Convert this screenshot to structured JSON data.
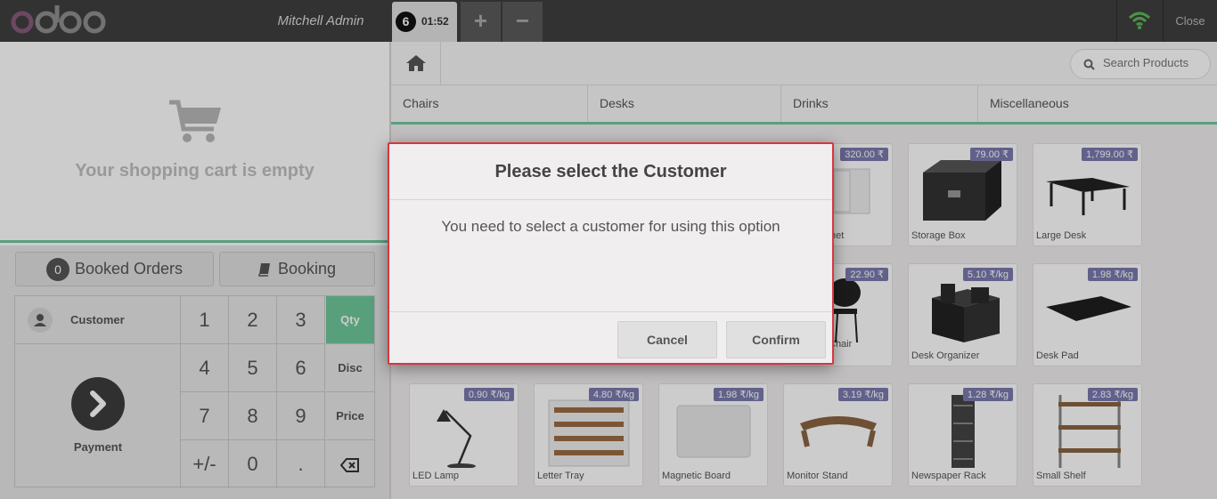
{
  "header": {
    "user_name": "Mitchell Admin",
    "order_number": "6",
    "order_time": "01:52",
    "add_label": "+",
    "remove_label": "−",
    "close_label": "Close",
    "logo_icon": "odoo-logo",
    "wifi_icon": "wifi-icon",
    "wifi_color": "#5cb85c"
  },
  "cart": {
    "empty_text": "Your shopping cart is empty",
    "icon": "cart-icon"
  },
  "controls": {
    "booked_count": "0",
    "booked_label": "Booked Orders",
    "booking_label": "Booking"
  },
  "pad": {
    "customer_label": "Customer",
    "payment_label": "Payment",
    "keys": [
      "1",
      "2",
      "3",
      "Qty",
      "4",
      "5",
      "6",
      "Disc",
      "7",
      "8",
      "9",
      "Price",
      "+/-",
      "0",
      "."
    ],
    "backspace_icon": "backspace-icon",
    "selected_mode": "Qty",
    "accent_color": "#6ec89b"
  },
  "products_header": {
    "search_placeholder": "Search Products",
    "categories": [
      "Chairs",
      "Desks",
      "Drinks",
      "Miscellaneous"
    ]
  },
  "products": [
    {
      "name": "Cabinet",
      "price": "320.00 ₹"
    },
    {
      "name": "Storage Box",
      "price": "79.00 ₹"
    },
    {
      "name": "Large Desk",
      "price": "1,799.00 ₹"
    },
    {
      "name": "Conference Chair",
      "price": "22.90 ₹"
    },
    {
      "name": "Desk Organizer",
      "price": "5.10 ₹/kg"
    },
    {
      "name": "Desk Pad",
      "price": "1.98 ₹/kg"
    },
    {
      "name": "LED Lamp",
      "price": "0.90 ₹/kg"
    },
    {
      "name": "Letter Tray",
      "price": "4.80 ₹/kg"
    },
    {
      "name": "Magnetic Board",
      "price": "1.98 ₹/kg"
    },
    {
      "name": "Monitor Stand",
      "price": "3.19 ₹/kg"
    },
    {
      "name": "Newspaper Rack",
      "price": "1.28 ₹/kg"
    },
    {
      "name": "Small Shelf",
      "price": "2.83 ₹/kg"
    }
  ],
  "partial_labels": {
    "cabinet_tail": "net",
    "chair_tail": "Chair",
    "chair_tail2": ")"
  },
  "modal": {
    "title": "Please select the Customer",
    "body": "You need to select a customer for using this option",
    "cancel_label": "Cancel",
    "confirm_label": "Confirm",
    "border_color": "#d9363e"
  }
}
